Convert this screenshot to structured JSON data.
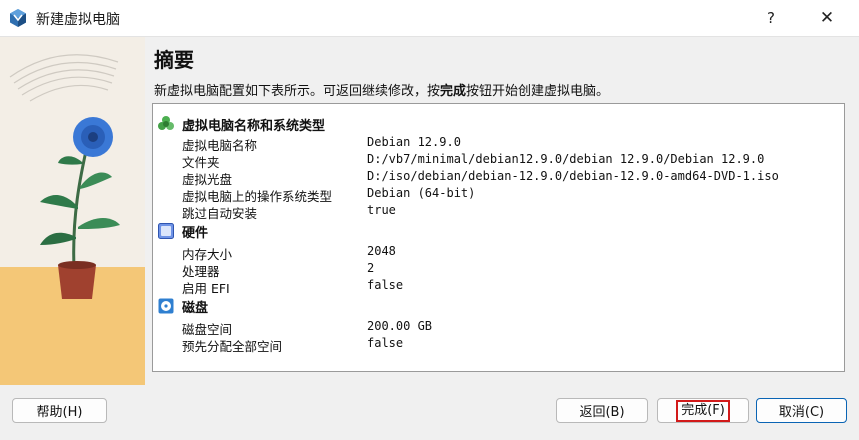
{
  "window": {
    "title": "新建虚拟电脑",
    "help_glyph": "?",
    "close_glyph": "✕"
  },
  "main": {
    "heading": "摘要",
    "description": {
      "before": "新虚拟电脑配置如下表所示。可返回继续修改，按",
      "bold": "完成",
      "after": "按钮开始创建虚拟电脑。"
    }
  },
  "sections": [
    {
      "title": "虚拟电脑名称和系统类型",
      "icon": "puzzle-piece-icon",
      "rows": [
        {
          "label": "虚拟电脑名称",
          "value": "Debian 12.9.0"
        },
        {
          "label": "文件夹",
          "value": "D:/vb7/minimal/debian12.9.0/debian 12.9.0/Debian 12.9.0"
        },
        {
          "label": "虚拟光盘",
          "value": "D:/iso/debian/debian-12.9.0/debian-12.9.0-amd64-DVD-1.iso"
        },
        {
          "label": "虚拟电脑上的操作系统类型",
          "value": "Debian (64-bit)"
        },
        {
          "label": "跳过自动安装",
          "value": "true"
        }
      ]
    },
    {
      "title": "硬件",
      "icon": "chip-icon",
      "rows": [
        {
          "label": "内存大小",
          "value": "2048"
        },
        {
          "label": "处理器",
          "value": "2"
        },
        {
          "label": "启用 EFI",
          "value": "false"
        }
      ]
    },
    {
      "title": "磁盘",
      "icon": "hard-disk-icon",
      "rows": [
        {
          "label": "磁盘空间",
          "value": "200.00 GB"
        },
        {
          "label": "预先分配全部空间",
          "value": "false"
        }
      ]
    }
  ],
  "buttons": {
    "help": "帮助(H)",
    "back": "返回(B)",
    "finish": "完成(F)",
    "cancel": "取消(C)"
  },
  "colors": {
    "finish_highlight": "#d21a1a",
    "default_button_border": "#0a64b4"
  }
}
